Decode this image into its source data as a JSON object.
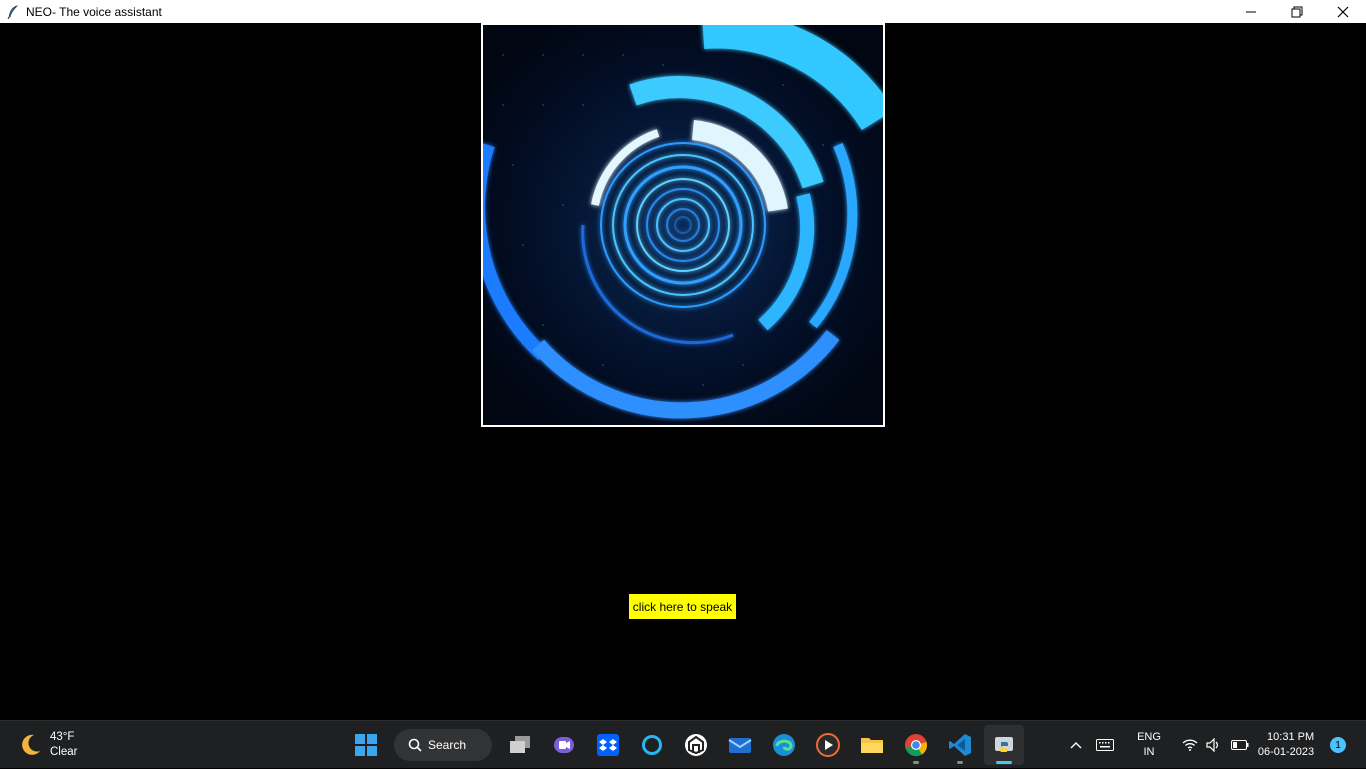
{
  "window": {
    "title": "NEO- The voice assistant",
    "icon": "feather-icon",
    "controls": [
      "minimize-icon",
      "restore-icon",
      "close-icon"
    ]
  },
  "main": {
    "speak_button_label": "click here to speak",
    "speak_button_color": "#ffff00",
    "visual": "circular-hud-animation"
  },
  "taskbar": {
    "weather": {
      "temp": "43°F",
      "condition": "Clear",
      "icon": "moon-icon"
    },
    "search_label": "Search",
    "apps": [
      "windows-start-icon",
      "search",
      "task-view-icon",
      "teams-chat-icon",
      "dropbox-icon",
      "cortana-icon",
      "app-icon",
      "mail-icon",
      "edge-icon",
      "media-player-icon",
      "file-explorer-icon",
      "chrome-icon",
      "vscode-icon",
      "python-icon"
    ],
    "language": {
      "line1": "ENG",
      "line2": "IN"
    },
    "clock": {
      "time": "10:31 PM",
      "date": "06-01-2023"
    },
    "notification_count": "1"
  },
  "colors": {
    "background": "#000000",
    "accent": "#4cc2ff",
    "taskbar": "#1f2021"
  }
}
